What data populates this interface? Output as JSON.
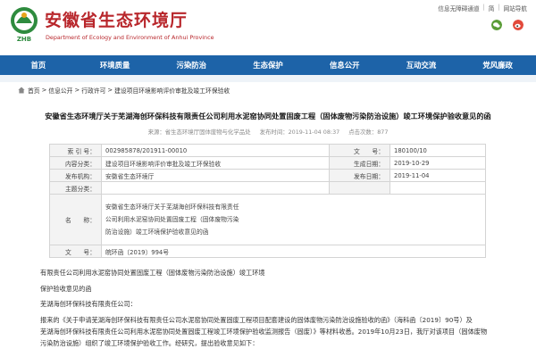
{
  "header": {
    "site_title": "安徽省生态环境厅",
    "site_subtitle": "Department of Ecology and Environment of Anhui Province",
    "logo_text": "ZHB",
    "top_links": [
      "信息无障碍通道",
      "简",
      "网站导航"
    ],
    "social_icons": [
      "wechat-icon",
      "weibo-icon"
    ]
  },
  "nav": {
    "items": [
      "首页",
      "环境质量",
      "污染防治",
      "生态保护",
      "信息公开",
      "互动交流",
      "党风廉政"
    ]
  },
  "breadcrumb": [
    "首页",
    "信息公开",
    "行政许可",
    "建设项目环境影响评价审批及竣工环保验收"
  ],
  "article": {
    "title": "安徽省生态环境厅关于芜湖海创环保科技有限责任公司利用水泥窑协同处置固废工程（固体废物污染防治设施）竣工环境保护验收意见的函",
    "source": "来源：省生态环境厅固体废物与化学品处",
    "date": "发布时间：2019-11-04 08:37",
    "views": "点击次数：877"
  },
  "info": {
    "index_label": "索 引 号：",
    "index_value": "002985878/201911-00010",
    "category_label": "内容分类：",
    "category_value": "建设项目环境影响评价审批及竣工环保验收",
    "org_label": "发布机构：",
    "org_value": "安徽省生态环境厅",
    "subject_label": "主题分类：",
    "subject_value": "",
    "name_label": "名　　称：",
    "name_lines": [
      "安徽省生态环境厅关于芜湖海创环保科技有限责任",
      "公司利用水泥窑协同处置固废工程（固体废物污染",
      "防治设施）竣工环境保护验收意见的函"
    ],
    "docno_label": "文　　号：",
    "docno_value": "皖环函〔2019〕994号",
    "doc_index_label": "文　　号：",
    "doc_index_value": "180100/10",
    "gen_date_label": "生成日期：",
    "gen_date_value": "2019-10-29",
    "pub_date_label": "发布日期：",
    "pub_date_value": "2019-11-04"
  },
  "body": {
    "lines": [
      "有限责任公司利用水泥窑协同处置固废工程（固体废物污染防治设施）竣工环境",
      "保护验收意见的函",
      "芜湖海创环保科技有限责任公司：",
      "报来的《关于申请芜湖海创环保科技有限责任公司水泥窑协同处置固废工程项目配套建设的固体废物污染防治设施验收的函》（海科函〔2019〕90号）及",
      "芜湖海创环保科技有限责任公司利用水泥窑协同处置固废工程竣工环境保护验收监测报告（固废）》等材料收悉。2019年10月23日，我厅对该项目（固体废物",
      "污染防治设施）组织了竣工环境保护验收工作。经研究，提出验收意见如下："
    ]
  },
  "colors": {
    "brand_red": "#b8262b",
    "nav_blue": "#1d63a8"
  }
}
